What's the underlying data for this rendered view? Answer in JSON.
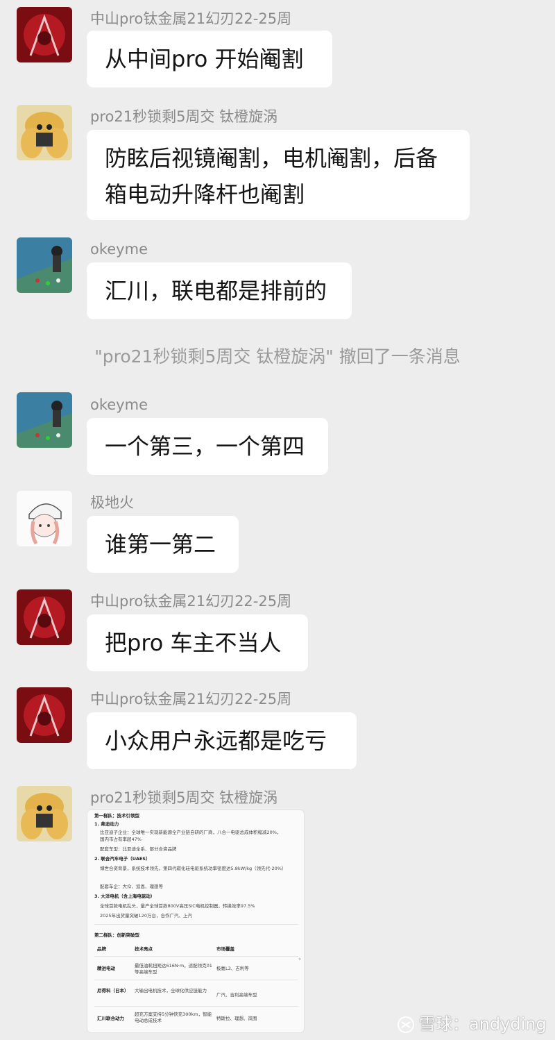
{
  "messages": [
    {
      "name": "中山pro钛金属21幻刃22-25周",
      "lines": [
        "从中间pro 开始阉割"
      ],
      "avatar": "red-armor-avatar"
    },
    {
      "name": "pro21秒锁剩5周交 钛橙旋涡",
      "lines": [
        "防眩后视镜阉割，电机阉割，后备",
        "箱电动升降杆也阉割"
      ],
      "avatar": "yellow-character-avatar"
    },
    {
      "name": "okeyme",
      "lines": [
        "汇川，联电都是排前的"
      ],
      "avatar": "child-photo-avatar"
    },
    {
      "name": "okeyme",
      "lines": [
        "一个第三，一个第四"
      ],
      "avatar": "child-photo-avatar"
    },
    {
      "name": "极地火",
      "lines": [
        "谁第一第二"
      ],
      "avatar": "anime-girl-avatar"
    },
    {
      "name": "中山pro钛金属21幻刃22-25周",
      "lines": [
        "把pro 车主不当人"
      ],
      "avatar": "red-armor-avatar"
    },
    {
      "name": "中山pro钛金属21幻刃22-25周",
      "lines": [
        "小众用户永远都是吃亏"
      ],
      "avatar": "red-armor-avatar"
    },
    {
      "name": "pro21秒锁剩5周交 钛橙旋涡",
      "avatar": "yellow-character-avatar"
    }
  ],
  "system_notice": "\"pro21秒锁剩5周交 钛橙旋涡\" 撤回了一条消息",
  "image_card": {
    "section1_title": "第一梯队：技术引领型",
    "items": [
      {
        "heading": "1. 弗迪动力",
        "bullets": [
          "比亚迪子企业：全球唯一实现新能源全产业链自研的厂商，八合一电驱总成体积缩减20%，",
          "国内市占有率超47%",
          "配套车型：比亚迪全系、部分合资品牌"
        ]
      },
      {
        "heading": "2. 联合汽车电子（UAES）",
        "bullets": [
          "博世合资背景，系统技术领先，第四代碳化硅电驱系统功率密度达5.8kW/kg（领先代-20%）",
          "配套车企：大众、追恩、理想等"
        ]
      },
      {
        "heading": "3. 大洋电机（含上海电驱动）",
        "bullets": [
          "全球首款电机乱头，量产全球首款800V高压SiC电机控制器，转换效率97.5%",
          "2025年出货量突破120万台，合作广汽、上汽"
        ]
      }
    ],
    "section2_title": "第二梯队：创新突破型",
    "table_headers": [
      "品牌",
      "技术亮点",
      "市场覆盖"
    ],
    "table_rows": [
      [
        "精进电动",
        "最低油耗扭矩达616N·m，适配领克01等高端车型",
        "极氪L3、吉利等"
      ],
      [
        "尼得科（日本）",
        "大输出电机技术，全球化供应链能力",
        "广汽、吉利高端车型"
      ],
      [
        "汇川联合动力",
        "超充方案支持5分钟快充300km，智能电动总成技术",
        "特斯拉、理想、岚图"
      ]
    ]
  },
  "watermark": "雪球：andyding"
}
